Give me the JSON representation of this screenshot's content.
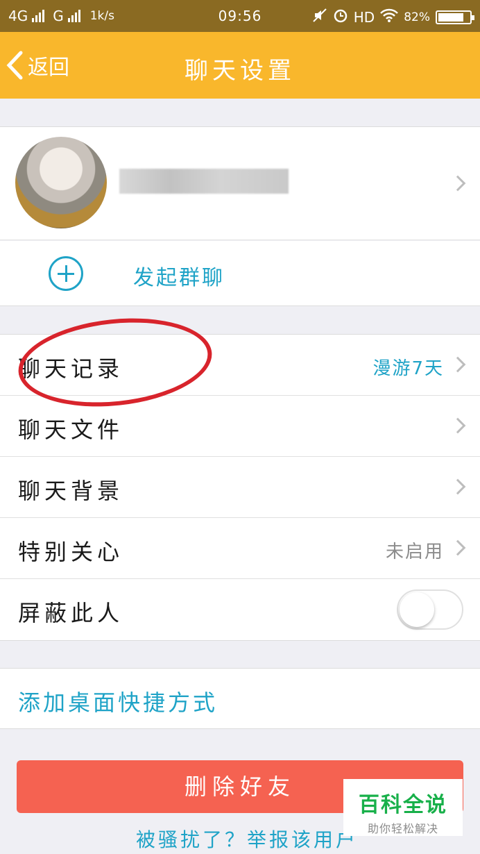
{
  "status_bar": {
    "network_1": "4G",
    "network_2": "G",
    "speed": "1k/s",
    "time": "09:56",
    "hd": "HD",
    "battery": "82%",
    "battery_level": 0.82,
    "icons": [
      "mute-icon",
      "alarm-icon",
      "wifi-icon",
      "battery-icon"
    ]
  },
  "nav": {
    "back_label": "返回",
    "title": "聊天设置"
  },
  "profile": {
    "name_redacted": true
  },
  "group": {
    "label": "发起群聊"
  },
  "settings": [
    {
      "label": "聊天记录",
      "value": "漫游7天",
      "value_color": "#1fa3c7"
    },
    {
      "label": "聊天文件",
      "value": ""
    },
    {
      "label": "聊天背景",
      "value": ""
    },
    {
      "label": "特别关心",
      "value": "未启用",
      "value_color": "#8c8c8c"
    },
    {
      "label": "屏蔽此人",
      "toggle": false
    }
  ],
  "shortcut": {
    "label": "添加桌面快捷方式"
  },
  "actions": {
    "delete_label": "删除好友",
    "report_label": "被骚扰了？举报该用户"
  },
  "watermark": {
    "title": "百科全说",
    "subtitle": "助你轻松解决"
  },
  "colors": {
    "nav_bg": "#f9b72c",
    "accent": "#1fa3c7",
    "delete": "#f56251",
    "annotation": "#d8242c"
  }
}
